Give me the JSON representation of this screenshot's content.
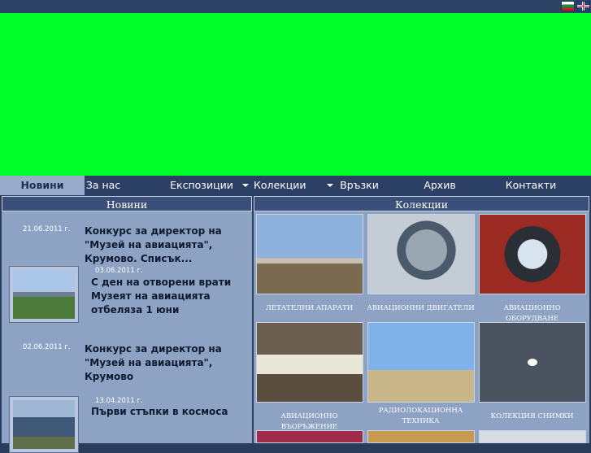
{
  "nav": [
    "Новини",
    "За нас",
    "Експозиции",
    "Колекции",
    "Връзки",
    "Архив",
    "Контакти"
  ],
  "left_header": "Новини",
  "right_header": "Колекции",
  "news": [
    {
      "date": "21.06.2011 г.",
      "title": "Конкурс за директор на \"Музей на авиацията\", Крумово. Списък..."
    },
    {
      "date": "03.06.2011 г.",
      "title": "С ден на отворени врати Музеят на авиацията отбеляза 1 юни"
    },
    {
      "date": "02.06.2011 г.",
      "title": "Конкурс за директор на \"Музей на авиацията\", Крумово"
    },
    {
      "date": "13.04.2011 г.",
      "title": "Първи стъпки в космоса"
    }
  ],
  "collections": [
    "ЛЕТАТЕЛНИ АПАРАТИ",
    "АВИАЦИОННИ ДВИГАТЕЛИ",
    "АВИАЦИОННО ОБОРУДВАНЕ",
    "АВИАЦИОННО ВЪОРЪЖЕНИЕ",
    "РАДИОЛОКАЦИОННА ТЕХНИКА",
    "КОЛЕКЦИЯ СНИМКИ"
  ],
  "colors": {
    "banner": "#00ff2a",
    "nav": "#2c4066",
    "panel": "#8ea2c4"
  }
}
